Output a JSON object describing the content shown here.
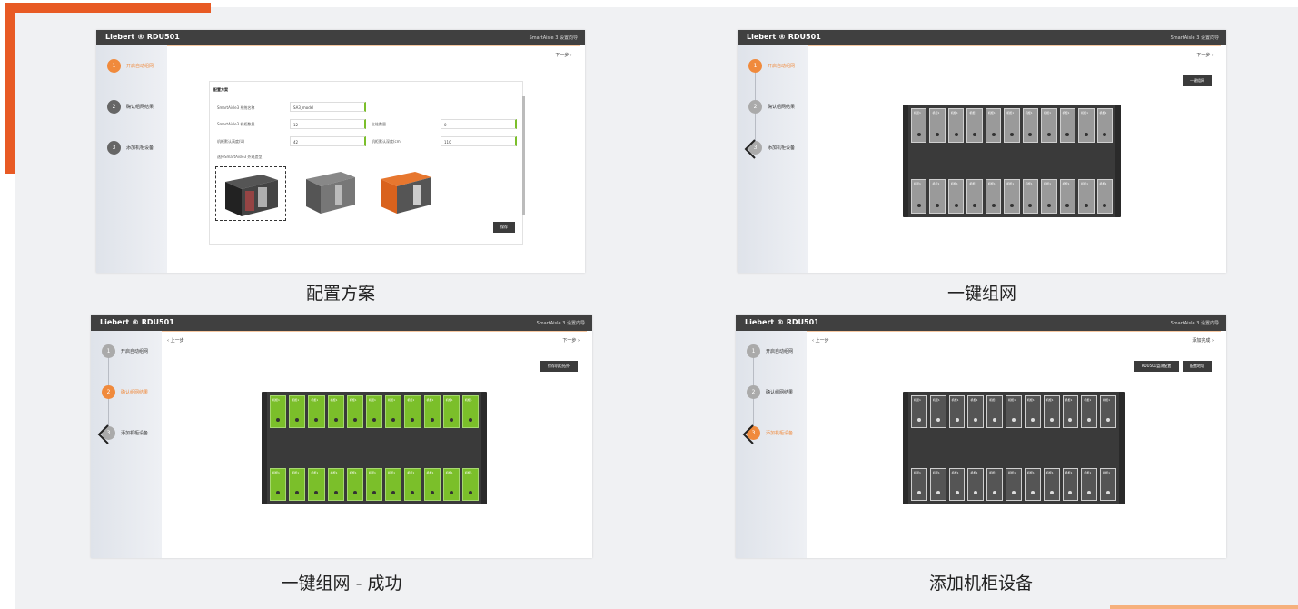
{
  "app": {
    "brand": "Liebert ® RDU501",
    "wizard_title": "SmartAisle 3 设置向导"
  },
  "steps": [
    "开启自动组网",
    "确认组网结果",
    "添加机柜设备"
  ],
  "nav": {
    "next": "下一步 ›",
    "prev": "‹ 上一步",
    "finish": "添加完成 ›"
  },
  "panel1": {
    "caption": "配置方案",
    "form_title": "配置方案",
    "fields": {
      "system_name_label": "SmartAisle3 系统名称",
      "system_name_value": "SA3_model",
      "cabinet_count_label": "SmartAisle3 机柜数量",
      "cabinet_count_value": "12",
      "aisle_count_label": "立柱数量",
      "aisle_count_value": "0",
      "cabinet_height_label": "机柜默认高度(U)",
      "cabinet_height_value": "42",
      "cabinet_depth_label": "机柜默认深度(cm)",
      "cabinet_depth_value": "110",
      "model_label": "选择SmartAisle3 外观造型"
    },
    "save_button": "保存"
  },
  "panel2": {
    "caption": "一键组网",
    "action_button": "一键组网"
  },
  "panel3": {
    "caption": "一键组网 - 成功",
    "action_button": "保存机柜拓扑"
  },
  "panel4": {
    "caption": "添加机柜设备",
    "button_a": "RDU501监测配置",
    "button_b": "配置地址"
  },
  "rack_cell_label": "机柜1",
  "colors": {
    "accent": "#e85a24",
    "active_step": "#f08a3c",
    "success_green": "#7bbf2a"
  }
}
